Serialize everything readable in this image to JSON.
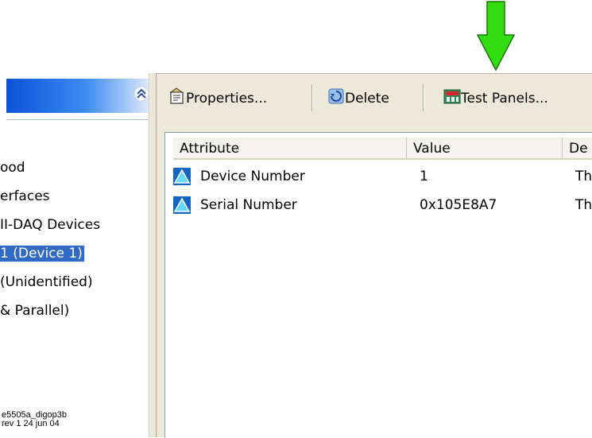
{
  "tree": {
    "items": [
      {
        "label": "ood",
        "selected": false
      },
      {
        "label": "erfaces",
        "selected": false
      },
      {
        "label": "II-DAQ Devices",
        "selected": false
      },
      {
        "label": "1 (Device 1)",
        "selected": true
      },
      {
        "label": "(Unidentified)",
        "selected": false
      },
      {
        "label": "& Parallel)",
        "selected": false
      }
    ]
  },
  "toolbar": {
    "properties_label": "Properties...",
    "delete_label": "Delete",
    "test_panels_label": "Test Panels..."
  },
  "table": {
    "columns": [
      "Attribute",
      "Value",
      "De"
    ],
    "rows": [
      {
        "attribute": "Device Number",
        "value": "1",
        "desc": "Th"
      },
      {
        "attribute": "Serial Number",
        "value": "0x105E8A7",
        "desc": "Th"
      }
    ]
  },
  "caption": {
    "line1": "e5505a_digop3b",
    "line2": "rev 1 24 jun 04"
  },
  "colors": {
    "arrow": "#33dd11",
    "selection": "#316ac5",
    "toolbar_bg": "#ece9d8"
  }
}
